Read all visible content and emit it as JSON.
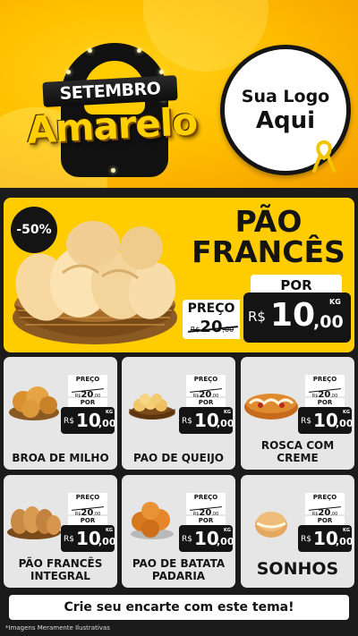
{
  "header": {
    "title_top": "SETEMBRO",
    "title_main": "Amarelo",
    "logo_line1": "Sua Logo",
    "logo_line2": "Aqui"
  },
  "featured": {
    "discount": "-50%",
    "name_line1": "PÃO",
    "name_line2": "FRANCÊS",
    "preco_label": "PREÇO",
    "old_currency": "R$",
    "old_int": "20",
    "old_dec": ",00",
    "por_label": "POR",
    "currency": "R$",
    "price_int": "10",
    "price_dec": ",00",
    "unit": "KG"
  },
  "products": [
    {
      "name": "BROA DE MILHO",
      "preco_label": "PREÇO",
      "old_currency": "R$",
      "old_int": "20",
      "old_dec": ",00",
      "por_label": "POR",
      "currency": "R$",
      "price_int": "10",
      "price_dec": ",00",
      "unit": "KG"
    },
    {
      "name": "PAO DE QUEIJO",
      "preco_label": "PREÇO",
      "old_currency": "R$",
      "old_int": "20",
      "old_dec": ",00",
      "por_label": "POR",
      "currency": "R$",
      "price_int": "10",
      "price_dec": ",00",
      "unit": "KG"
    },
    {
      "name": "ROSCA COM CREME",
      "preco_label": "PREÇO",
      "old_currency": "R$",
      "old_int": "20",
      "old_dec": ",00",
      "por_label": "POR",
      "currency": "R$",
      "price_int": "10",
      "price_dec": ",00",
      "unit": "KG"
    },
    {
      "name": "PÃO FRANCÊS INTEGRAL",
      "preco_label": "PREÇO",
      "old_currency": "R$",
      "old_int": "20",
      "old_dec": ",00",
      "por_label": "POR",
      "currency": "R$",
      "price_int": "10",
      "price_dec": ",00",
      "unit": "KG"
    },
    {
      "name": "PAO DE BATATA PADARIA",
      "preco_label": "PREÇO",
      "old_currency": "R$",
      "old_int": "20",
      "old_dec": ",00",
      "por_label": "POR",
      "currency": "R$",
      "price_int": "10",
      "price_dec": ",00",
      "unit": "KG"
    },
    {
      "name": "SONHOS",
      "preco_label": "PREÇO",
      "old_currency": "R$",
      "old_int": "20",
      "old_dec": ",00",
      "por_label": "POR",
      "currency": "R$",
      "price_int": "10",
      "price_dec": ",00",
      "unit": "KG"
    }
  ],
  "cta": "Crie seu encarte com este tema!",
  "disclaimer": "*Imagens Meramente Ilustrativas",
  "colors": {
    "accent": "#ffcc00",
    "dark": "#141414",
    "card": "#e6e6e6"
  }
}
